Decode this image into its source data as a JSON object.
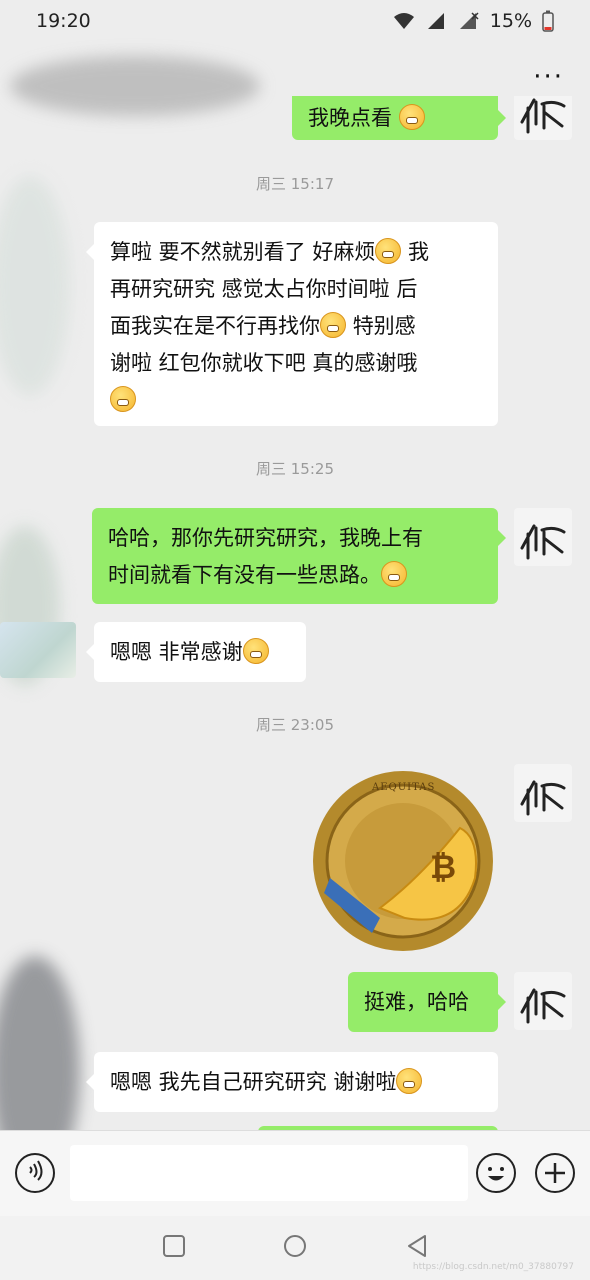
{
  "status_bar": {
    "time": "19:20",
    "battery": "15%"
  },
  "header": {
    "more_label": "···"
  },
  "chat": {
    "partial_top_message": "我晚点看",
    "messages": [
      {
        "type": "time",
        "text": "周三 15:17"
      },
      {
        "type": "in",
        "lines": [
          "算啦 要不然就别看了 好麻烦",
          "再研究研究 感觉太占你时间啦 后",
          "面我实在是不行再找你",
          "谢啦 红包你就收下吧 真的感谢哦"
        ],
        "segments": {
          "l1a": "算啦 要不然就别看了 好麻烦",
          "l1b": "我",
          "l2": "再研究研究 感觉太占你时间啦 后",
          "l3a": "面我实在是不行再找你",
          "l3b": "特别感",
          "l4": "谢啦 红包你就收下吧 真的感谢哦"
        }
      },
      {
        "type": "time",
        "text": "周三 15:25"
      },
      {
        "type": "out",
        "segments": {
          "l1": "哈哈，那你先研究研究，我晚上有",
          "l2": "时间就看下有没有一些思路。"
        }
      },
      {
        "type": "in",
        "segments": {
          "l1": "嗯嗯 非常感谢"
        }
      },
      {
        "type": "time",
        "text": "周三 23:05"
      },
      {
        "type": "sticker",
        "coin_text": "AEQUITAS"
      },
      {
        "type": "out",
        "segments": {
          "l1": "挺难，哈哈"
        }
      },
      {
        "type": "in",
        "segments": {
          "l1": "嗯嗯 我先自己研究研究 谢谢啦"
        }
      }
    ],
    "avatar_glyph": "秋"
  },
  "input_bar": {
    "placeholder": ""
  },
  "watermark": "https://blog.csdn.net/m0_37880797",
  "colors": {
    "out_bubble": "#95ec69",
    "in_bubble": "#ffffff",
    "background": "#ededed"
  },
  "icons": [
    "wifi-icon",
    "signal-icon",
    "battery-icon",
    "more-icon",
    "voice-icon",
    "emoji-icon",
    "plus-icon",
    "square-nav-icon",
    "home-nav-icon",
    "back-nav-icon"
  ]
}
